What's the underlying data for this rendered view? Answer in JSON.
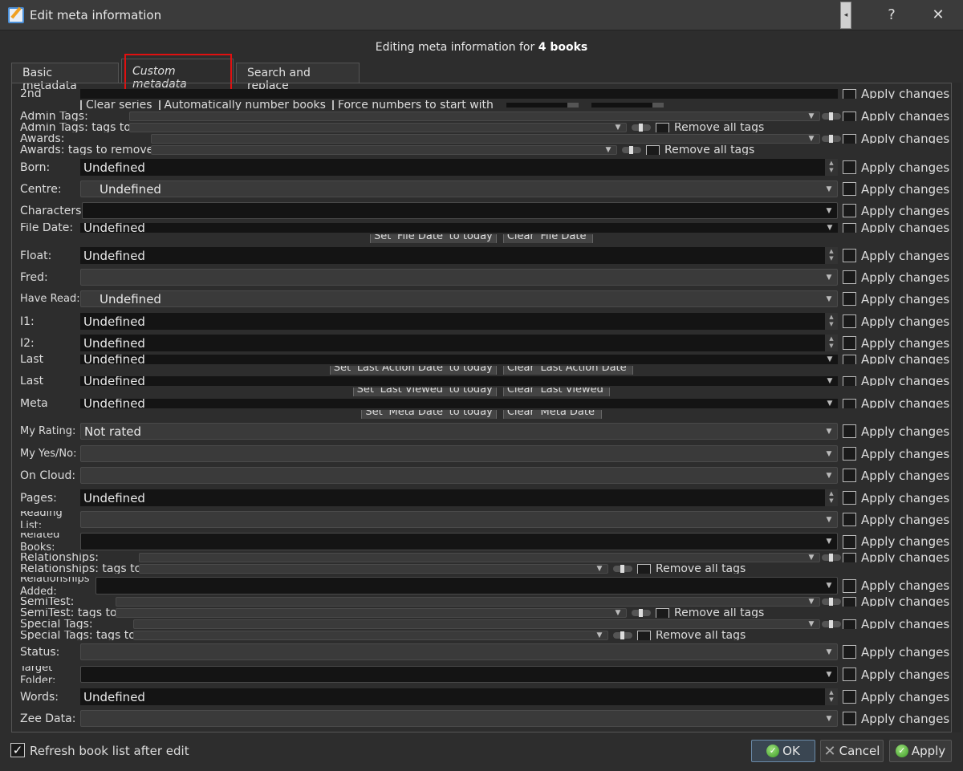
{
  "window": {
    "title": "Edit meta information",
    "help": "?",
    "close": "✕"
  },
  "heading": {
    "prefix": "Editing meta information for ",
    "count": "4 books"
  },
  "tabs": [
    {
      "label": "Basic metadata"
    },
    {
      "label": "Custom metadata",
      "active": true
    },
    {
      "label": "Search and replace"
    }
  ],
  "apply_label": "Apply changes",
  "remove_all_tags": "Remove all tags",
  "series_options": [
    "Clear series",
    "Automatically number books",
    "Force numbers to start with"
  ],
  "rows": [
    {
      "label": "2nd",
      "kind": "text",
      "value": ""
    },
    {
      "label": "Admin Tags:",
      "kind": "tagcombo",
      "value": ""
    },
    {
      "label": "Admin Tags: tags to",
      "kind": "tagremove",
      "value": ""
    },
    {
      "label": "Awards:",
      "kind": "tagcombo",
      "value": ""
    },
    {
      "label": "Awards: tags to remove",
      "kind": "tagremove",
      "value": ""
    },
    {
      "label": "Born:",
      "kind": "spin",
      "value": "Undefined"
    },
    {
      "label": "Centre:",
      "kind": "combo",
      "value": "Undefined"
    },
    {
      "label": "Characters:",
      "kind": "edit",
      "value": ""
    },
    {
      "label": "File Date:",
      "kind": "date",
      "value": "Undefined",
      "buttons": [
        "Set 'File Date' to today",
        "Clear 'File Date'"
      ]
    },
    {
      "label": "Float:",
      "kind": "spin",
      "value": "Undefined"
    },
    {
      "label": "Fred:",
      "kind": "combo",
      "value": ""
    },
    {
      "label": "Have Read:",
      "kind": "combo",
      "value": "Undefined"
    },
    {
      "label": "I1:",
      "kind": "spin",
      "value": "Undefined"
    },
    {
      "label": "I2:",
      "kind": "spin",
      "value": "Undefined"
    },
    {
      "label": "Last",
      "kind": "date",
      "value": "Undefined",
      "buttons": [
        "Set 'Last Action Date' to today",
        "Clear 'Last Action Date'"
      ]
    },
    {
      "label": "Last",
      "kind": "date",
      "value": "Undefined",
      "buttons": [
        "Set 'Last Viewed' to today",
        "Clear 'Last Viewed'"
      ]
    },
    {
      "label": "Meta",
      "kind": "date",
      "value": "Undefined",
      "buttons": [
        "Set 'Meta Date' to today",
        "Clear 'Meta Date'"
      ]
    },
    {
      "label": "My Rating:",
      "kind": "combo",
      "value": "Not rated"
    },
    {
      "label": "My Yes/No:",
      "kind": "combo",
      "value": ""
    },
    {
      "label": "On Cloud:",
      "kind": "combo",
      "value": ""
    },
    {
      "label": "Pages:",
      "kind": "spin",
      "value": "Undefined"
    },
    {
      "label": "Reading List:",
      "kind": "combo",
      "value": ""
    },
    {
      "label": "Related Books:",
      "kind": "edit",
      "value": ""
    },
    {
      "label": "Relationships:",
      "kind": "tagcombo",
      "value": ""
    },
    {
      "label": "Relationships: tags to",
      "kind": "tagremove",
      "value": ""
    },
    {
      "label": "Relationships Added:",
      "kind": "edit",
      "value": ""
    },
    {
      "label": "SemiTest:",
      "kind": "tagcombo",
      "value": ""
    },
    {
      "label": "SemiTest: tags to",
      "kind": "tagremove",
      "value": ""
    },
    {
      "label": "Special Tags:",
      "kind": "tagcombo",
      "value": ""
    },
    {
      "label": "Special Tags: tags to",
      "kind": "tagremove",
      "value": ""
    },
    {
      "label": "Status:",
      "kind": "combo",
      "value": ""
    },
    {
      "label": "Target Folder:",
      "kind": "edit",
      "value": ""
    },
    {
      "label": "Words:",
      "kind": "spin",
      "value": "Undefined"
    },
    {
      "label": "Zee Data:",
      "kind": "combo",
      "value": ""
    }
  ],
  "footer": {
    "refresh_label": "Refresh book list after edit",
    "refresh_checked": true,
    "ok": "OK",
    "cancel": "Cancel",
    "apply": "Apply"
  }
}
